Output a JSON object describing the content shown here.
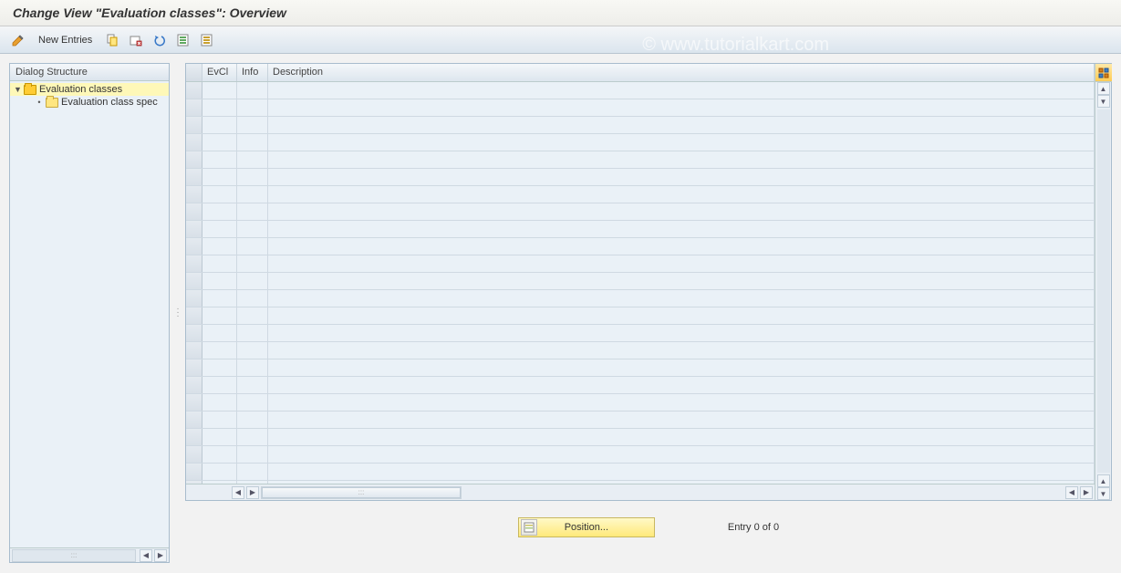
{
  "header": {
    "title": "Change View \"Evaluation classes\": Overview"
  },
  "toolbar": {
    "new_entries_label": "New Entries"
  },
  "dialog_structure": {
    "title": "Dialog Structure",
    "nodes": [
      {
        "label": "Evaluation classes",
        "expanded": true,
        "selected": true
      },
      {
        "label": "Evaluation class spec",
        "expanded": false,
        "selected": false
      }
    ]
  },
  "table": {
    "columns": {
      "evcl": "EvCl",
      "info": "Info",
      "description": "Description"
    },
    "row_count": 24,
    "rows": []
  },
  "footer": {
    "position_button": "Position...",
    "entry_text": "Entry 0 of 0"
  },
  "watermark": "© www.tutorialkart.com"
}
